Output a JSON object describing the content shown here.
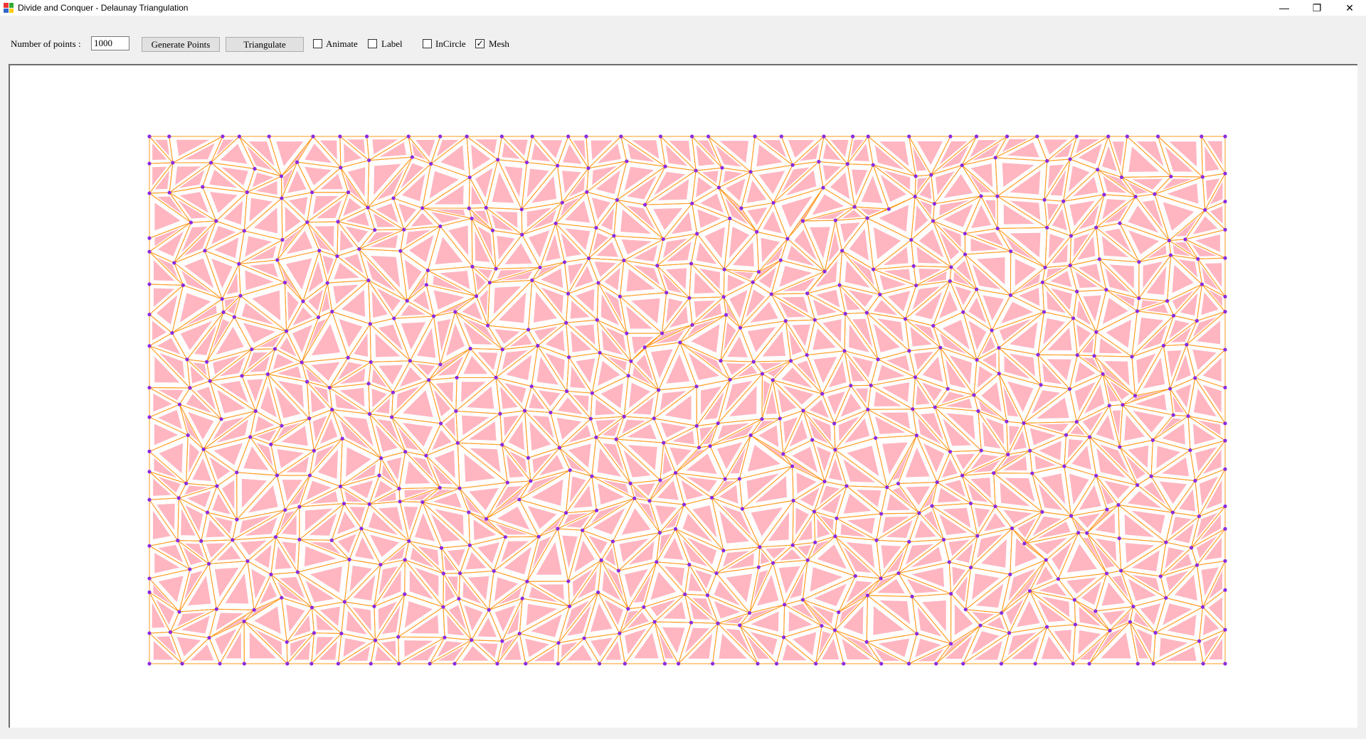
{
  "window": {
    "title": "Divide and Conquer - Delaunay Triangulation",
    "controls": [
      "minimize",
      "restore",
      "close"
    ]
  },
  "toolbar": {
    "points_label": "Number of points :",
    "points_value": "1000",
    "generate_label": "Generate Points",
    "triangulate_label": "Triangulate",
    "checkboxes": [
      {
        "label": "Animate",
        "checked": false
      },
      {
        "label": "Label",
        "checked": false
      },
      {
        "label": "InCircle",
        "checked": false
      },
      {
        "label": "Mesh",
        "checked": true
      }
    ]
  },
  "colors": {
    "edge": "#ff9a1e",
    "point": "#8a2be2",
    "triangle_fill": "#ffb6c1",
    "canvas": "#ffffff"
  },
  "icons": {
    "app": "app-grid-icon",
    "minimize": "minimize-icon",
    "restore": "restore-icon",
    "close": "close-icon"
  },
  "mesh": {
    "point_count": 1000,
    "hull_corners_label": ""
  }
}
